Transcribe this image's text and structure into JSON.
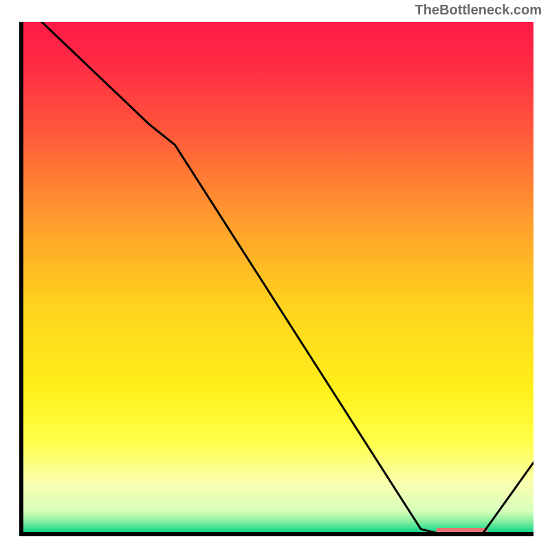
{
  "attribution": "TheBottleneck.com",
  "chart_data": {
    "type": "line",
    "title": "",
    "xlabel": "",
    "ylabel": "",
    "xlim": [
      0,
      100
    ],
    "ylim": [
      0,
      100
    ],
    "x": [
      0,
      4,
      25,
      30,
      78,
      82,
      90,
      100
    ],
    "values": [
      103,
      100,
      80,
      76,
      1,
      0,
      0,
      14
    ],
    "gradient_stops": [
      {
        "offset": 0,
        "color": "#ff1a47"
      },
      {
        "offset": 0.08,
        "color": "#ff2a44"
      },
      {
        "offset": 0.22,
        "color": "#ff5a3a"
      },
      {
        "offset": 0.38,
        "color": "#ff9a2e"
      },
      {
        "offset": 0.55,
        "color": "#ffd21e"
      },
      {
        "offset": 0.72,
        "color": "#fff01a"
      },
      {
        "offset": 0.82,
        "color": "#ffff4a"
      },
      {
        "offset": 0.9,
        "color": "#fbffb0"
      },
      {
        "offset": 0.955,
        "color": "#d7ffba"
      },
      {
        "offset": 0.975,
        "color": "#87f0a0"
      },
      {
        "offset": 0.995,
        "color": "#15d68b"
      },
      {
        "offset": 1.0,
        "color": "#0bce86"
      }
    ],
    "highlight_bar": {
      "x_start": 81,
      "x_end": 91,
      "color": "#e57373"
    },
    "line_color": "#000000",
    "axis_color": "#000000"
  }
}
